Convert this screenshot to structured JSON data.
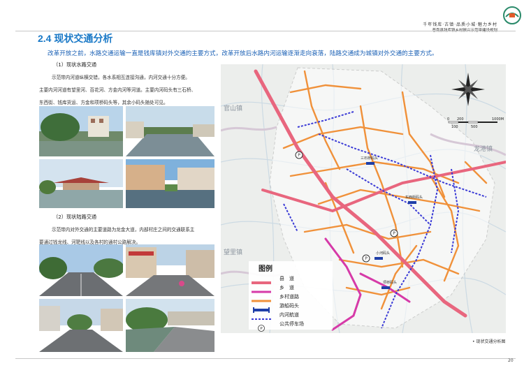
{
  "header": {
    "brand_line1": "千年钱库·古镇·品质小城·魅力乡村",
    "brand_line2": "苍南县钱库镇乡村振兴示范带建设规划"
  },
  "section": {
    "title": "2.4  现状交通分析",
    "intro": "改革开放之前，水路交通运输一直是钱库镇对外交通的主要方式，改革开放后水路内河运输逐渐走向衰落，陆路交通成为城镇对外交通的主要方式。"
  },
  "water": {
    "heading": "（1）现状水路交通",
    "lines": [
      "示范带内河道纵横交错，各水系相互连接沟通，内河交通十分方便。",
      "主要内河河道有望里河、百花河、方金内河等河道。主要内河码头有三石桥、",
      "东西街、钱库货运、方金和项桥码头等，其余小码头随处可见。"
    ]
  },
  "land": {
    "heading": "（2）现状陆路交通",
    "lines": [
      "示范带内对外交通的主要道路为龙金大道，内部村庄之间的交通联系主",
      "要通过钱龙线、河靶线以及各村的通村公路解决。"
    ]
  },
  "map": {
    "place_labels": [
      "官山镇",
      "龙港镇",
      "望里镇"
    ],
    "node_labels": [
      "三石桥码头",
      "东西街码头",
      "小河码头",
      "项桥码头"
    ],
    "scale_labels": [
      "0",
      "200",
      "1000M",
      "100",
      "500"
    ],
    "legend_title": "图例",
    "legend": [
      {
        "label": "县　道",
        "color": "#e8667e"
      },
      {
        "label": "乡　道",
        "color": "#d63aa8"
      },
      {
        "label": "乡村道路",
        "color": "#f0913a"
      },
      {
        "label": "游船码头",
        "color": "#1f3fa8"
      },
      {
        "label": "内河航道",
        "color": "#3a3ad6"
      },
      {
        "label": "公共停车场",
        "color": "#333333"
      }
    ],
    "parking_symbol": "P"
  },
  "caption": "• 现状交通分析图",
  "page_number": "20"
}
